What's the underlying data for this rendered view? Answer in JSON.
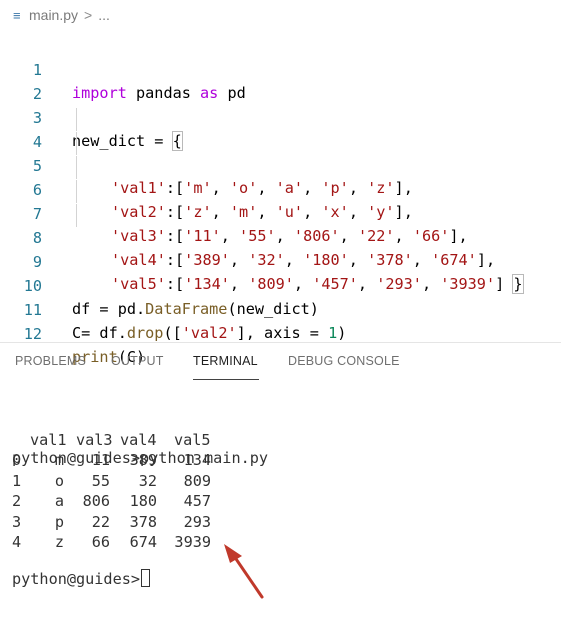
{
  "breadcrumb": {
    "file": "main.py",
    "separator": ">",
    "more": "..."
  },
  "editor": {
    "lines": [
      {
        "n": "1"
      },
      {
        "n": "2"
      },
      {
        "n": "3"
      },
      {
        "n": "4"
      },
      {
        "n": "5"
      },
      {
        "n": "6"
      },
      {
        "n": "7"
      },
      {
        "n": "8"
      },
      {
        "n": "9"
      },
      {
        "n": "10"
      },
      {
        "n": "11"
      },
      {
        "n": "12"
      }
    ],
    "code": {
      "l1": [
        "import",
        " pandas ",
        "as",
        " pd"
      ],
      "l3": [
        "new_dict = ",
        "{"
      ],
      "l4": [
        "'val1'",
        ":[",
        "'m'",
        ", ",
        "'o'",
        ", ",
        "'a'",
        ", ",
        "'p'",
        ", ",
        "'z'",
        "],"
      ],
      "l5": [
        "'val2'",
        ":[",
        "'z'",
        ", ",
        "'m'",
        ", ",
        "'u'",
        ", ",
        "'x'",
        ", ",
        "'y'",
        "],"
      ],
      "l6": [
        "'val3'",
        ":[",
        "'11'",
        ", ",
        "'55'",
        ", ",
        "'806'",
        ", ",
        "'22'",
        ", ",
        "'66'",
        "],"
      ],
      "l7": [
        "'val4'",
        ":[",
        "'389'",
        ", ",
        "'32'",
        ", ",
        "'180'",
        ", ",
        "'378'",
        ", ",
        "'674'",
        "],"
      ],
      "l8": [
        "'val5'",
        ":[",
        "'134'",
        ", ",
        "'809'",
        ", ",
        "'457'",
        ", ",
        "'293'",
        ", ",
        "'3939'",
        "] ",
        "}"
      ],
      "l10": [
        "df = pd.",
        "DataFrame",
        "(new_dict)"
      ],
      "l11": [
        "C= df.",
        "drop",
        "([",
        "'val2'",
        "], axis = ",
        "1",
        ")"
      ],
      "l12": [
        "print",
        "(C)"
      ]
    }
  },
  "panel": {
    "tabs": [
      "PROBLEMS",
      "OUTPUT",
      "TERMINAL",
      "DEBUG CONSOLE"
    ],
    "active_tab": "TERMINAL"
  },
  "terminal": {
    "command_line": "python@guides>python main.py",
    "table": {
      "columns": [
        "val1",
        "val3",
        "val4",
        "val5"
      ],
      "rows": [
        {
          "index": "0",
          "val1": "m",
          "val3": "11",
          "val4": "389",
          "val5": "134"
        },
        {
          "index": "1",
          "val1": "o",
          "val3": "55",
          "val4": "32",
          "val5": "809"
        },
        {
          "index": "2",
          "val1": "a",
          "val3": "806",
          "val4": "180",
          "val5": "457"
        },
        {
          "index": "3",
          "val1": "p",
          "val3": "22",
          "val4": "378",
          "val5": "293"
        },
        {
          "index": "4",
          "val1": "z",
          "val3": "66",
          "val4": "674",
          "val5": "3939"
        }
      ]
    },
    "prompt": "python@guides>"
  },
  "colors": {
    "arrow": "#c0392b",
    "line_number": "#237893",
    "string": "#a31515",
    "keyword": "#0000ff"
  }
}
